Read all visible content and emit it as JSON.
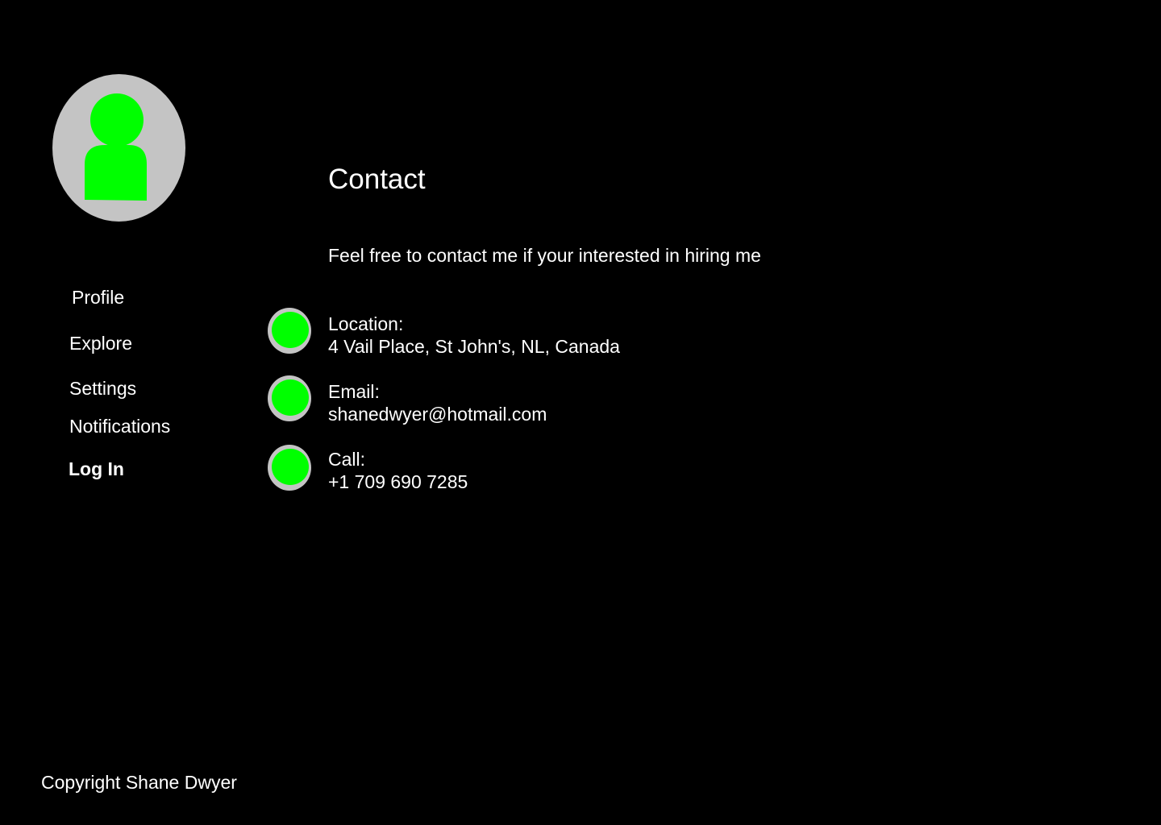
{
  "sidebar": {
    "avatar_icon": "user-avatar-icon",
    "nav_items": [
      {
        "label": "Profile"
      },
      {
        "label": "Explore"
      },
      {
        "label": "Settings"
      },
      {
        "label": "Notifications"
      },
      {
        "label": "Log In"
      }
    ]
  },
  "main": {
    "title": "Contact",
    "intro": "Feel free to contact me if your interested in hiring me",
    "contacts": [
      {
        "icon": "location-icon",
        "label": "Location:",
        "value": "4 Vail Place, St John's, NL, Canada"
      },
      {
        "icon": "email-icon",
        "label": "Email:",
        "value": "shanedwyer@hotmail.com"
      },
      {
        "icon": "phone-icon",
        "label": "Call:",
        "value": "+1 709 690 7285"
      }
    ]
  },
  "footer": {
    "copyright": "Copyright Shane Dwyer"
  },
  "colors": {
    "background": "#000000",
    "accent": "#00ff00",
    "icon_ring": "#c4c4c4",
    "text": "#ffffff"
  }
}
